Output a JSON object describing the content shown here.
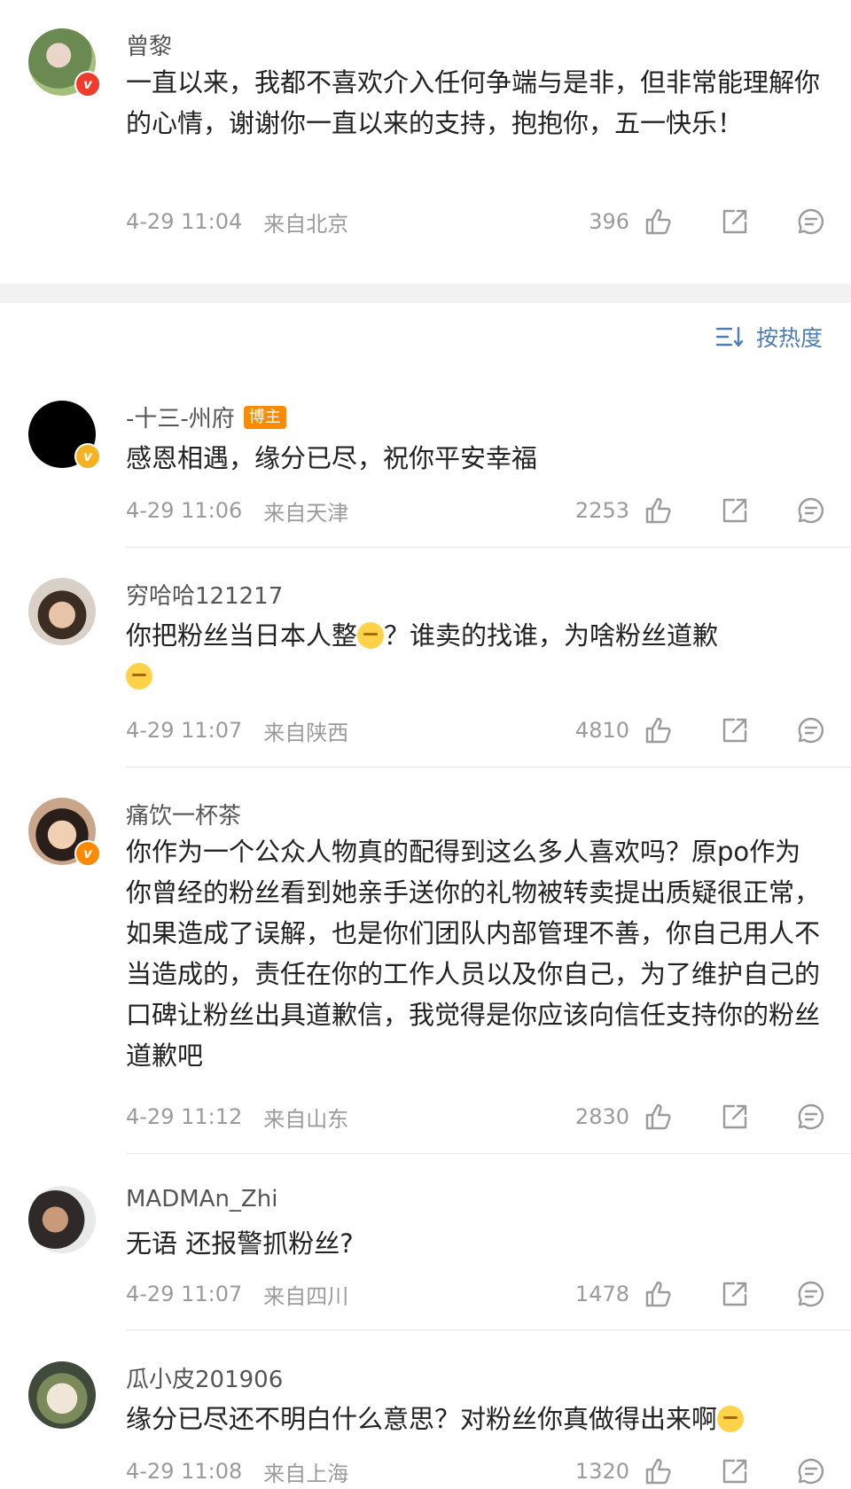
{
  "sort": {
    "label": "按热度"
  },
  "comments": [
    {
      "user": "曾黎",
      "badge": "v",
      "text": "一直以来，我都不喜欢介入任何争端与是非，但非常能理解你的心情，谢谢你一直以来的支持，抱抱你，五一快乐！",
      "time": "4-29 11:04",
      "location": "来自北京",
      "likes": "396"
    },
    {
      "user": "-十三-州府",
      "tag": "博主",
      "badge": "v",
      "text": "感恩相遇，缘分已尽，祝你平安幸福",
      "time": "4-29 11:06",
      "location": "来自天津",
      "likes": "2253"
    },
    {
      "user": "穷哈哈121217",
      "text_a": "你把粉丝当日本人整",
      "text_b": "？谁卖的找谁，为啥粉丝道歉",
      "time": "4-29 11:07",
      "location": "来自陕西",
      "likes": "4810"
    },
    {
      "user": "痛饮一杯茶",
      "badge": "v",
      "text": "你作为一个公众人物真的配得到这么多人喜欢吗？原po作为你曾经的粉丝看到她亲手送你的礼物被转卖提出质疑很正常，如果造成了误解，也是你们团队内部管理不善，你自己用人不当造成的，责任在你的工作人员以及你自己，为了维护自己的口碑让粉丝出具道歉信，我觉得是你应该向信任支持你的粉丝道歉吧",
      "time": "4-29 11:12",
      "location": "来自山东",
      "likes": "2830"
    },
    {
      "user": "MADMAn_Zhi",
      "text": "无语 还报警抓粉丝?",
      "time": "4-29 11:07",
      "location": "来自四川",
      "likes": "1478"
    },
    {
      "user": "瓜小皮201906",
      "text": "缘分已尽还不明白什么意思？对粉丝你真做得出来啊",
      "time": "4-29 11:08",
      "location": "来自上海",
      "likes": "1320"
    }
  ],
  "colors": {
    "accent": "#4f7db8",
    "meta": "#9b9b9b",
    "badge_red": "#f03a2b",
    "badge_gold": "#f5b324",
    "badge_orange": "#ff8a00"
  }
}
